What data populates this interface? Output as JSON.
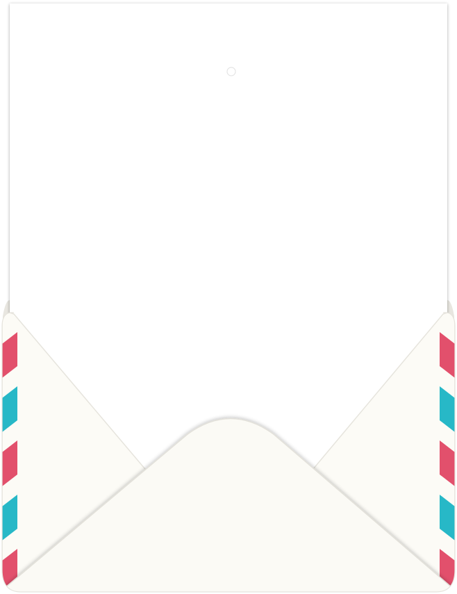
{
  "colors": {
    "background": "#ffffff",
    "letter_paper": "#ffffff",
    "letter_shadow": "#d9d9d9",
    "envelope_paper": "#fcfbf6",
    "envelope_edge": "#e3e1da",
    "stripe_red": "#e2506c",
    "stripe_teal": "#27b8c7",
    "divider_line": "#eeeeee"
  },
  "icons": {
    "divider_ornament": "circle-ornament-icon"
  }
}
